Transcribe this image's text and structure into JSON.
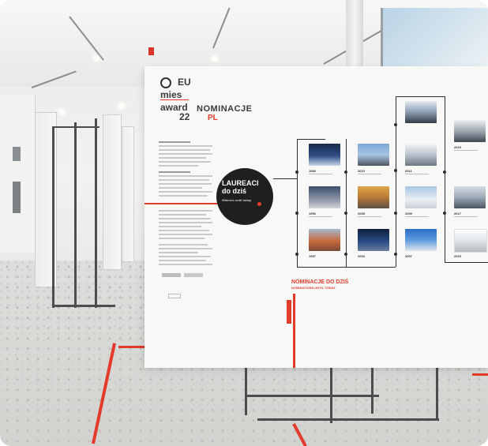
{
  "board": {
    "logo_line1": "EU",
    "logo_line2": "mies",
    "logo_line3": "award",
    "logo_line4": "22",
    "nominacje": "NOMINACJE",
    "pl": "PL",
    "laureaci_line1": "LAUREACI",
    "laureaci_line2": "do dziś",
    "winners_until_today": "Winners until today",
    "nominacje_do_dzis": "NOMINACJE DO DZIŚ",
    "nominations_until_today": "NOMINATIONS UNTIL TODAY"
  },
  "timeline": {
    "years": [
      "1990",
      "1996",
      "1997",
      "2001",
      "2003",
      "2005",
      "2011",
      "2009",
      "2007",
      "2015",
      "2017",
      "2019",
      "2015"
    ]
  },
  "colors": {
    "accent_red": "#e23b2c",
    "board": "#f8f8f7",
    "circle": "#1f1f1f"
  }
}
